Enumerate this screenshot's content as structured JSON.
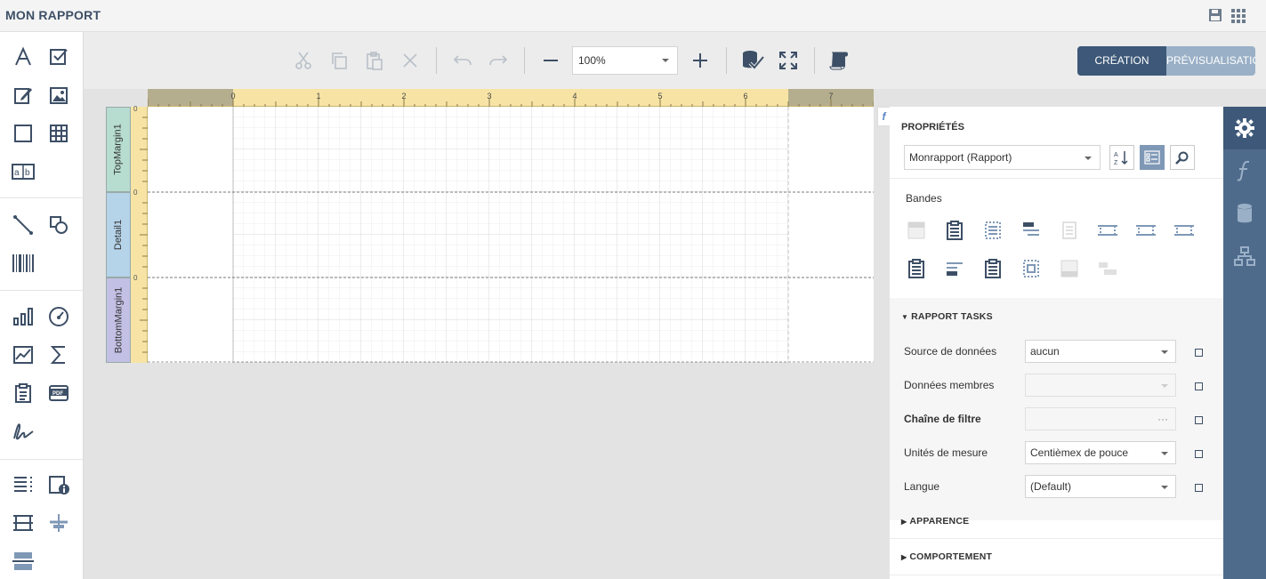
{
  "app": {
    "title": "MON RAPPORT"
  },
  "titlebar_icons": [
    "save-icon",
    "apps-grid-icon"
  ],
  "toolbox": {
    "groups": [
      [
        "label-icon",
        "checkbox-icon",
        "rich-text-icon",
        "picture-box-icon",
        "panel-icon",
        "table-icon",
        "character-comb-icon"
      ],
      [
        "line-icon",
        "shape-icon",
        "barcode-icon"
      ],
      [
        "chart-icon",
        "gauge-icon",
        "sparkline-icon",
        "summary-icon",
        "subreport-icon",
        "pdf-content-icon",
        "signature-icon"
      ],
      [
        "table-of-contents-icon",
        "page-info-icon",
        "cross-band-line-icon",
        "cross-band-box-icon",
        "page-break-icon"
      ]
    ]
  },
  "toolbar": {
    "zoom_value": "100%",
    "buttons": [
      "cut-icon",
      "copy-icon",
      "paste-icon",
      "delete-icon",
      "undo-icon",
      "redo-icon",
      "zoom-out-icon",
      "zoom-in-icon",
      "validate-bindings-icon",
      "fullscreen-icon",
      "report-wizard-icon"
    ],
    "mode_design": "CRÉATION",
    "mode_preview": "PRÉVISUALISATION"
  },
  "design_surface": {
    "ruler_ticks": [
      "0",
      "1",
      "2",
      "3",
      "4",
      "5",
      "6",
      "7"
    ],
    "bands": [
      {
        "name": "TopMargin1",
        "color": "#b7dcd0"
      },
      {
        "name": "Detail1",
        "color": "#b5d3e9"
      },
      {
        "name": "BottomMargin1",
        "color": "#c2c0e4"
      }
    ],
    "vertical_ruler_zero": "0"
  },
  "properties": {
    "title": "PROPRIÉTÉS",
    "object_selector": "Monrapport (Rapport)",
    "bands_label": "Bandes",
    "tasks_title": "RAPPORT TASKS",
    "rows": [
      {
        "label": "Source de données",
        "value": "aucun",
        "bold": false,
        "type": "select",
        "disabled": false
      },
      {
        "label": "Données membres",
        "value": "",
        "bold": false,
        "type": "select",
        "disabled": true
      },
      {
        "label": "Chaîne de filtre",
        "value": "",
        "bold": true,
        "type": "ellipsis",
        "disabled": true,
        "ellipsis": "···"
      },
      {
        "label": "Unités de mesure",
        "value": "Centièmex de pouce",
        "bold": false,
        "type": "select",
        "disabled": false
      },
      {
        "label": "Langue",
        "value": "(Default)",
        "bold": false,
        "type": "select",
        "disabled": false
      }
    ],
    "sections": [
      "APPARENCE",
      "COMPORTEMENT"
    ],
    "fx_tab": "f"
  },
  "right_sidebar": [
    "gear-icon",
    "function-icon",
    "database-icon",
    "hierarchy-icon"
  ],
  "colors": {
    "accent_dark": "#3d4f66",
    "sidebar": "#4f6b8c",
    "ruler": "#f7e4a5",
    "active_view_btn": "#3d5878"
  }
}
